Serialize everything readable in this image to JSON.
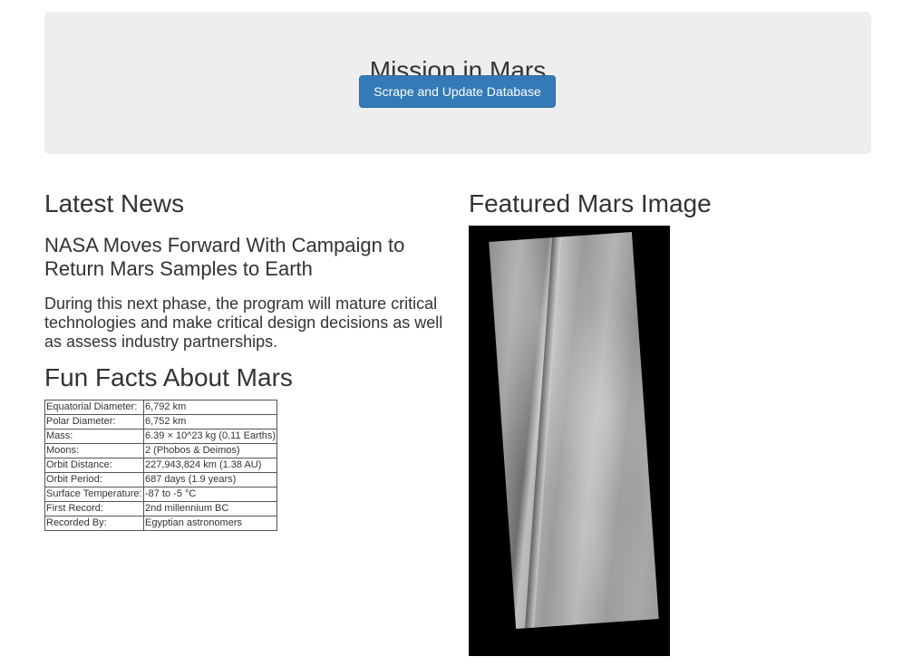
{
  "header": {
    "title": "Mission in Mars",
    "scrape_button_label": "Scrape and Update Database"
  },
  "news": {
    "section_title": "Latest News",
    "headline": "NASA Moves Forward With Campaign to Return Mars Samples to Earth",
    "teaser": "During this next phase, the program will mature critical technologies and make critical design decisions as well as assess industry partnerships."
  },
  "facts": {
    "section_title": "Fun Facts About Mars",
    "rows": [
      {
        "label": "Equatorial Diameter:",
        "value": "6,792 km"
      },
      {
        "label": "Polar Diameter:",
        "value": "6,752 km"
      },
      {
        "label": "Mass:",
        "value": "6.39 × 10^23 kg (0.11 Earths)"
      },
      {
        "label": "Moons:",
        "value": "2 (Phobos & Deimos)"
      },
      {
        "label": "Orbit Distance:",
        "value": "227,943,824 km (1.38 AU)"
      },
      {
        "label": "Orbit Period:",
        "value": "687 days (1.9 years)"
      },
      {
        "label": "Surface Temperature:",
        "value": "-87 to -5 °C"
      },
      {
        "label": "First Record:",
        "value": "2nd millennium BC"
      },
      {
        "label": "Recorded By:",
        "value": "Egyptian astronomers"
      }
    ]
  },
  "featured_image": {
    "section_title": "Featured Mars Image"
  }
}
